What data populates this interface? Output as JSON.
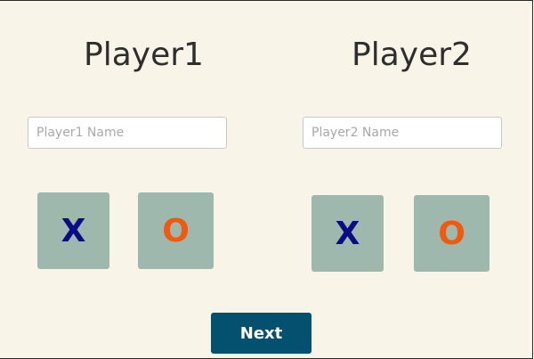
{
  "player1": {
    "title": "Player1",
    "name_value": "",
    "name_placeholder": "Player1 Name",
    "symbols": [
      {
        "label": "X",
        "color": "#0b0b86"
      },
      {
        "label": "O",
        "color": "#f0590e"
      }
    ]
  },
  "player2": {
    "title": "Player2",
    "name_value": "",
    "name_placeholder": "Player2 Name",
    "symbols": [
      {
        "label": "X",
        "color": "#0b0b86"
      },
      {
        "label": "O",
        "color": "#f0590e"
      }
    ]
  },
  "next_label": "Next",
  "colors": {
    "background": "#f8f5e8",
    "tile": "#9fb8ad",
    "button": "#03506f",
    "title_text": "#2e2e2e"
  }
}
